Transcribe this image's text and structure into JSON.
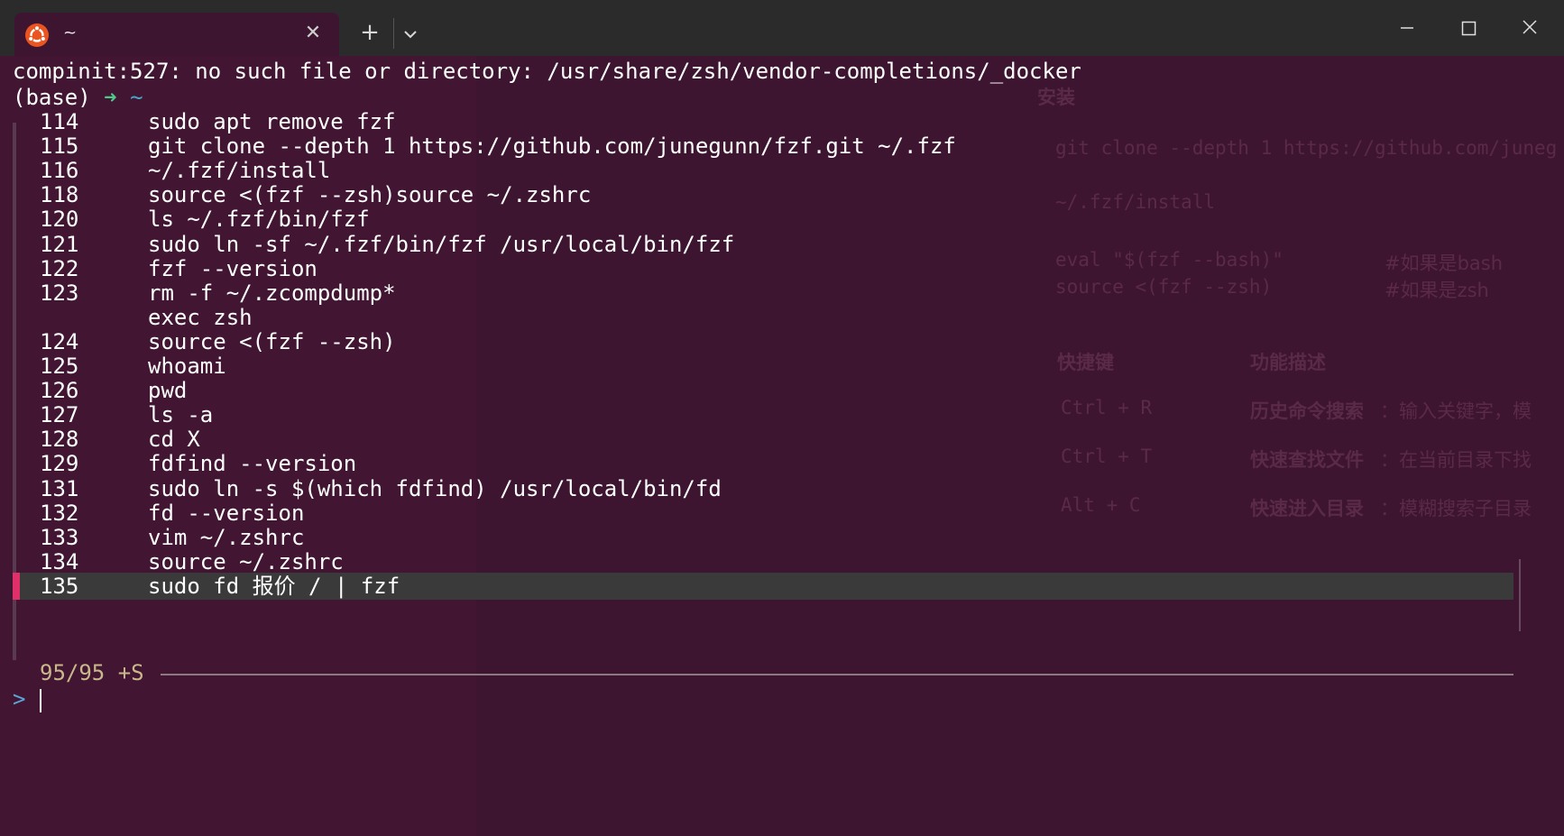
{
  "window": {
    "tab_title": "~",
    "tab_icon": "ubuntu-icon",
    "new_tab": "+",
    "accent": "#e95420"
  },
  "background_ghost": {
    "lines": [
      "git clone --depth 1 https://github.com/juneg",
      "~/.fzf/install",
      "eval \"$(fzf --bash)\"",
      "source <(fzf --zsh)"
    ],
    "comments": [
      "#如果是bash",
      "#如果是zsh"
    ],
    "section": "安装",
    "table_headers": [
      "快捷键",
      "功能描述"
    ],
    "table_rows": [
      {
        "key": "Ctrl + R",
        "title": "历史命令搜索",
        "desc": "：输入关键字，模"
      },
      {
        "key": "Ctrl + T",
        "title": "快速查找文件",
        "desc": "：在当前目录下找"
      },
      {
        "key": "Alt + C",
        "title": "快速进入目录",
        "desc": "：模糊搜索子目录"
      }
    ]
  },
  "terminal": {
    "error_line": "compinit:527: no such file or directory: /usr/share/zsh/vendor-completions/_docker",
    "prompt": {
      "env": "(base)",
      "arrow": "➜",
      "dir": "~"
    },
    "history": [
      {
        "num": "114",
        "cmd": "sudo apt remove fzf"
      },
      {
        "num": "115",
        "cmd": "git clone --depth 1 https://github.com/junegunn/fzf.git ~/.fzf"
      },
      {
        "num": "116",
        "cmd": "~/.fzf/install"
      },
      {
        "num": "118",
        "cmd": "source <(fzf --zsh)source ~/.zshrc"
      },
      {
        "num": "120",
        "cmd": "ls ~/.fzf/bin/fzf"
      },
      {
        "num": "121",
        "cmd": "sudo ln -sf ~/.fzf/bin/fzf /usr/local/bin/fzf"
      },
      {
        "num": "122",
        "cmd": "fzf --version"
      },
      {
        "num": "123",
        "cmd": "rm -f ~/.zcompdump*"
      },
      {
        "num": "",
        "cmd": "exec zsh"
      },
      {
        "num": "124",
        "cmd": "source <(fzf --zsh)"
      },
      {
        "num": "125",
        "cmd": "whoami"
      },
      {
        "num": "126",
        "cmd": "pwd"
      },
      {
        "num": "127",
        "cmd": "ls -a"
      },
      {
        "num": "128",
        "cmd": "cd X"
      },
      {
        "num": "129",
        "cmd": "fdfind --version"
      },
      {
        "num": "131",
        "cmd": "sudo ln -s $(which fdfind) /usr/local/bin/fd"
      },
      {
        "num": "132",
        "cmd": "fd --version"
      },
      {
        "num": "133",
        "cmd": "vim ~/.zshrc"
      },
      {
        "num": "134",
        "cmd": "source ~/.zshrc"
      },
      {
        "num": "135",
        "cmd": "sudo fd 报价 / | fzf"
      }
    ],
    "selected_index": 19,
    "counter": "95/95 +S",
    "input_prompt": ">",
    "input_value": ""
  }
}
